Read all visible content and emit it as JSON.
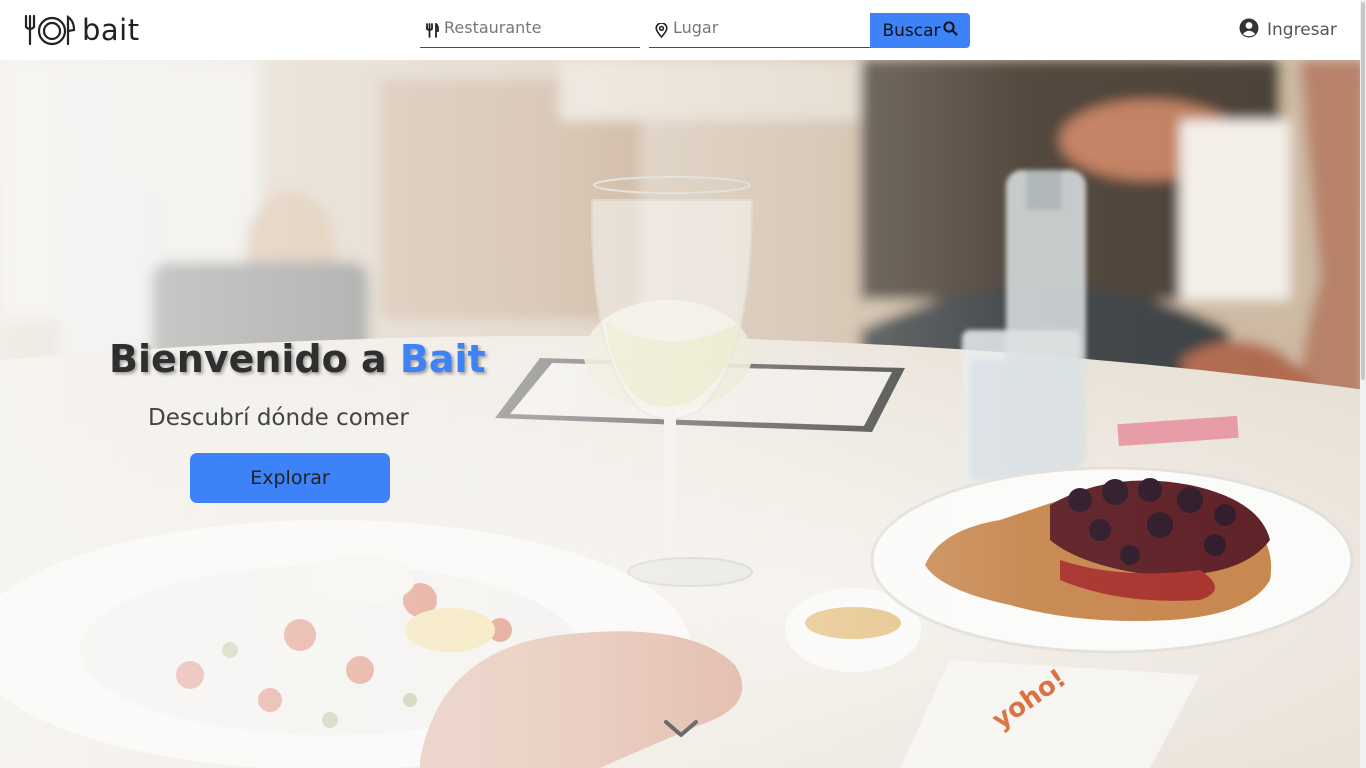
{
  "brand": {
    "name": "bait",
    "logo_icon": "plate-cutlery-icon"
  },
  "search": {
    "restaurant_placeholder": "Restaurante",
    "restaurant_icon": "fork-knife-icon",
    "place_placeholder": "Lugar",
    "place_icon": "map-pin-icon",
    "button_label": "Buscar",
    "button_icon": "search-icon"
  },
  "auth": {
    "login_label": "Ingresar",
    "icon": "user-circle-icon"
  },
  "hero": {
    "title_prefix": "Bienvenido a ",
    "title_brand": "Bait",
    "subtitle": "Descubrí dónde comer",
    "cta_label": "Explorar",
    "scroll_icon": "chevron-down-icon"
  },
  "colors": {
    "accent": "#3d82f7",
    "header_bg": "#ffffff",
    "text": "#2f2f2f"
  }
}
